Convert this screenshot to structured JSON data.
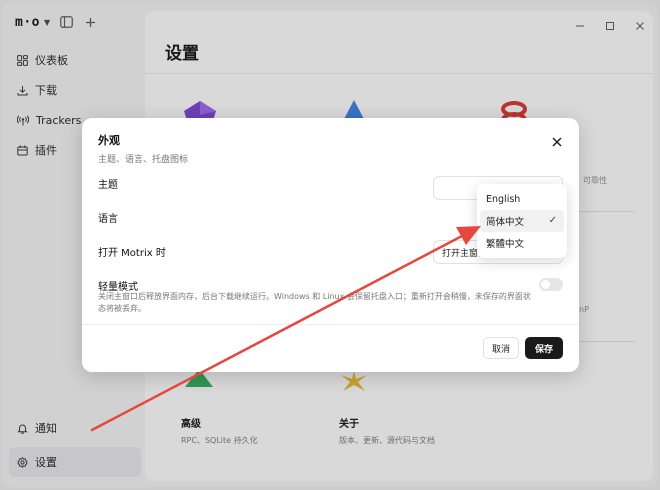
{
  "app": {
    "logo": "m·o"
  },
  "sidebar": {
    "items": [
      {
        "label": "仪表板",
        "icon": "dashboard-icon"
      },
      {
        "label": "下载",
        "icon": "download-icon"
      },
      {
        "label": "Trackers",
        "icon": "broadcast-icon"
      },
      {
        "label": "插件",
        "icon": "plugin-icon"
      }
    ],
    "bottom": [
      {
        "label": "通知",
        "icon": "bell-icon"
      },
      {
        "label": "设置",
        "icon": "gear-icon"
      }
    ]
  },
  "main": {
    "title": "设置",
    "cards": [
      {
        "title": "高级",
        "desc": "RPC、SQLite 持久化"
      },
      {
        "title": "关于",
        "desc": "版本、更新、源代码与文档"
      }
    ],
    "side_texts": [
      "可靠性",
      "nP"
    ]
  },
  "dialog": {
    "title": "外观",
    "subtitle": "主题、语言、托盘图标",
    "rows": {
      "theme_label": "主题",
      "language_label": "语言",
      "on_open_label": "打开 Motrix 时",
      "on_open_value": "打开主窗口",
      "light_mode_label": "轻量模式",
      "light_mode_desc": "关闭主窗口后释放界面内存，后台下载继续运行。Windows 和 Linux 会保留托盘入口；重新打开会稍慢，未保存的界面状态将被丢弃。"
    },
    "cancel_label": "取消",
    "save_label": "保存"
  },
  "language_dropdown": {
    "options": [
      "English",
      "简体中文",
      "繁體中文"
    ],
    "selected": "简体中文",
    "check": "✓"
  },
  "colors": {
    "annotation_arrow": "#e5483f",
    "save_button": "#1a1a1a"
  }
}
